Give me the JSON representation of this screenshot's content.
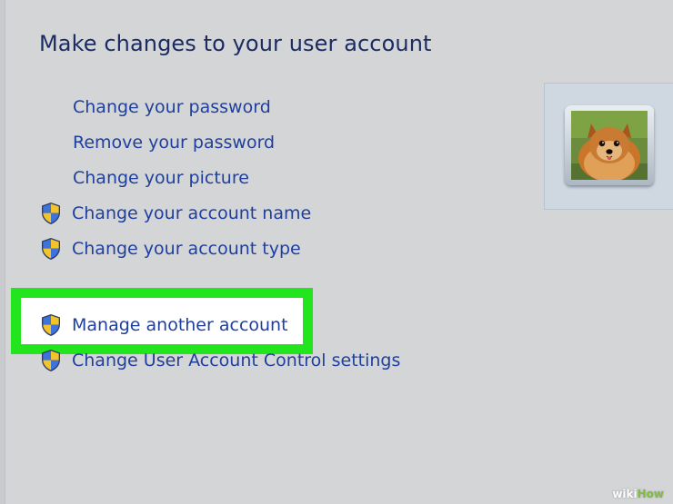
{
  "window": {
    "title": "Make changes to your user account"
  },
  "tasks": [
    {
      "label": "Change your password",
      "has_shield": false
    },
    {
      "label": "Remove your password",
      "has_shield": false
    },
    {
      "label": "Change your picture",
      "has_shield": false
    },
    {
      "label": "Change your account name",
      "has_shield": true
    },
    {
      "label": "Change your account type",
      "has_shield": true
    },
    {
      "label": "Manage another account",
      "has_shield": true,
      "highlighted": true
    },
    {
      "label": "Change User Account Control settings",
      "has_shield": true
    }
  ],
  "icons": {
    "shield": "uac-shield-icon",
    "account_picture": "pomeranian-dog-photo"
  },
  "colors": {
    "background": "#d4d5d7",
    "title": "#1c2c63",
    "link": "#1f3f9e",
    "highlight": "#22e51e"
  },
  "watermark": {
    "part1": "wiki",
    "part2": "How"
  }
}
